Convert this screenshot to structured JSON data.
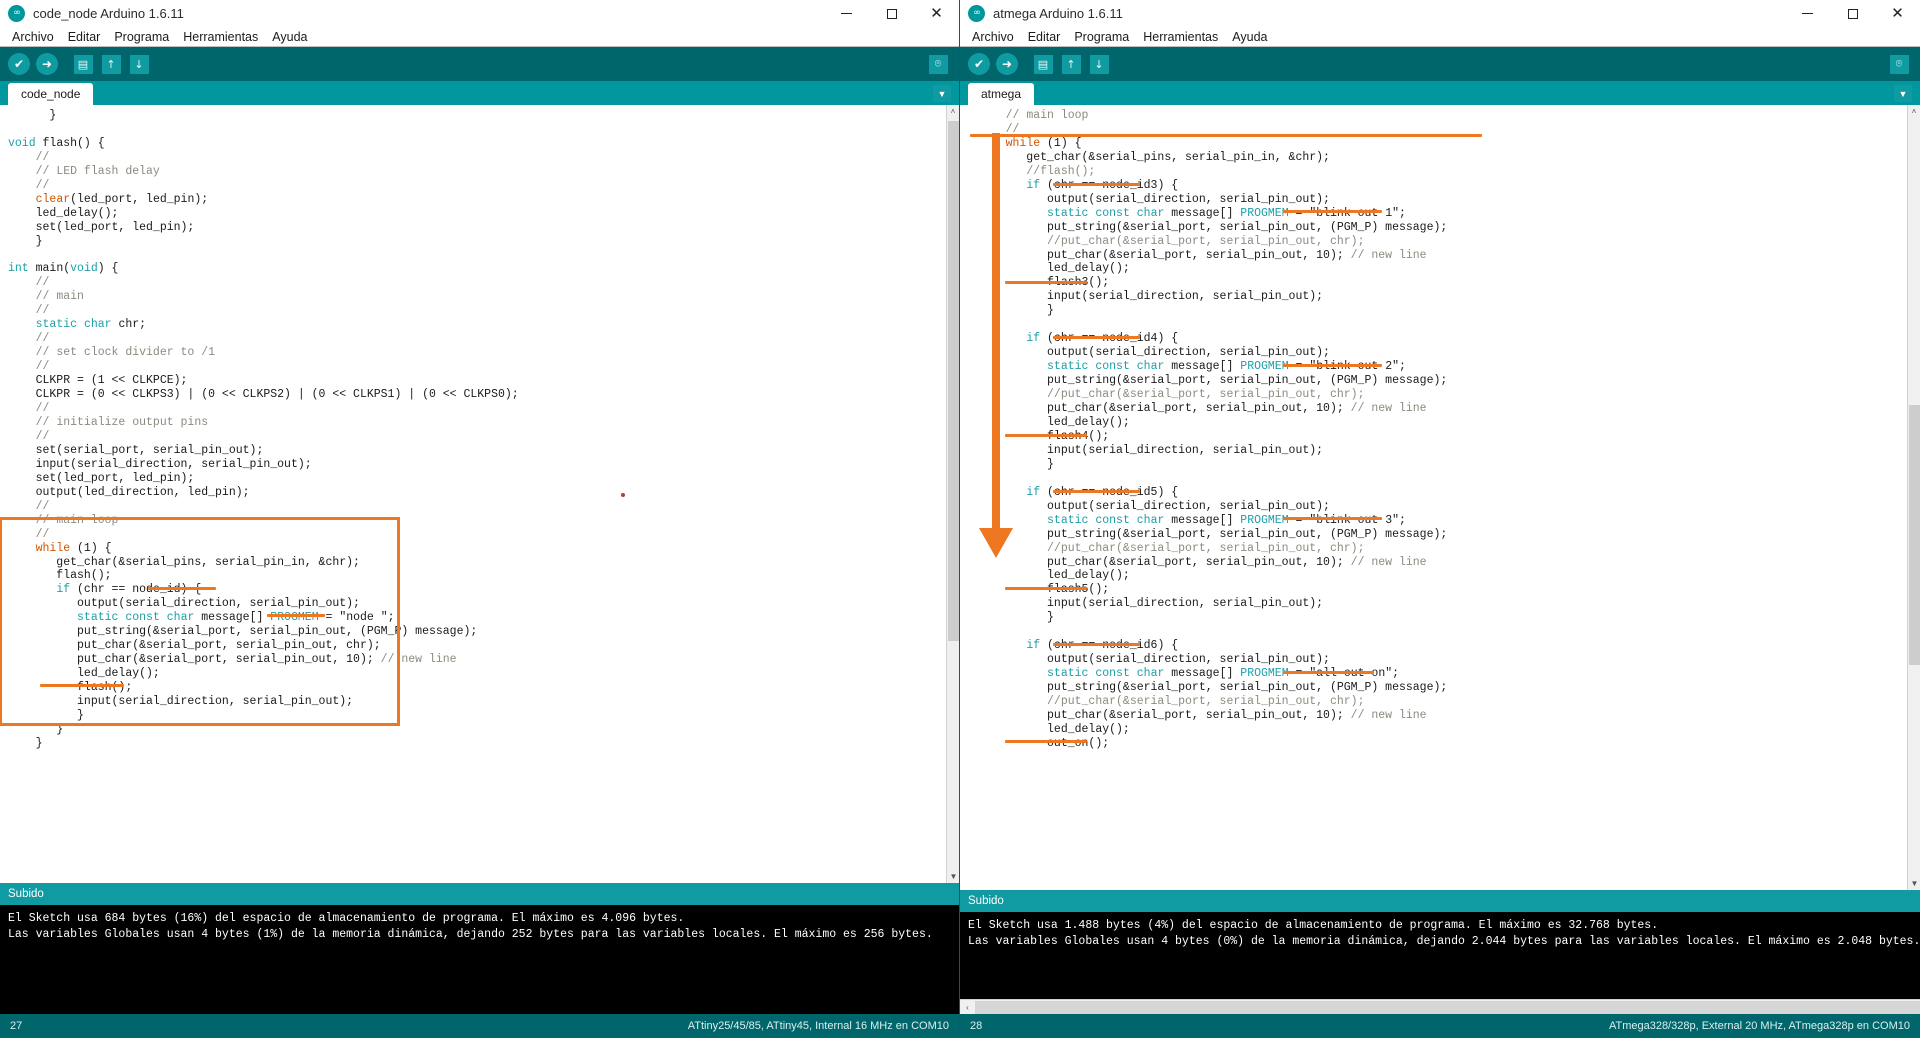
{
  "windows": {
    "left": {
      "title": "code_node Arduino 1.6.11",
      "menu": [
        "Archivo",
        "Editar",
        "Programa",
        "Herramientas",
        "Ayuda"
      ],
      "toolbar": {
        "verify": "verify-check",
        "upload": "upload-arrow",
        "new": "new-file",
        "open": "open-folder",
        "save": "save-disk",
        "serial_monitor": "serial-monitor"
      },
      "tab": "code_node",
      "status": "Subido",
      "console": [
        "El Sketch usa 684 bytes (16%) del espacio de almacenamiento de programa. El máximo es 4.096 bytes.",
        "Las variables Globales usan 4 bytes (1%) de la memoria dinámica, dejando 252 bytes para las variables locales. El máximo es 256 bytes."
      ],
      "line_number": "27",
      "board_info": "ATtiny25/45/85, ATtiny45, Internal 16 MHz en COM10",
      "code": [
        {
          "t": "      }"
        },
        {
          "t": ""
        },
        {
          "t": "<span class=\"kw\">void</span> flash() {"
        },
        {
          "t": "    <span class=\"cm\">//</span>"
        },
        {
          "t": "    <span class=\"cm\">// LED flash delay</span>"
        },
        {
          "t": "    <span class=\"cm\">//</span>"
        },
        {
          "t": "    <span class=\"kw2\">clear</span>(led_port, led_pin);"
        },
        {
          "t": "    led_delay();"
        },
        {
          "t": "    set(led_port, led_pin);"
        },
        {
          "t": "    }"
        },
        {
          "t": ""
        },
        {
          "t": "<span class=\"kw\">int</span> main(<span class=\"kw\">void</span>) {"
        },
        {
          "t": "    <span class=\"cm\">//</span>"
        },
        {
          "t": "    <span class=\"cm\">// main</span>"
        },
        {
          "t": "    <span class=\"cm\">//</span>"
        },
        {
          "t": "    <span class=\"kw\">static</span> <span class=\"kw\">char</span> chr;"
        },
        {
          "t": "    <span class=\"cm\">//</span>"
        },
        {
          "t": "    <span class=\"cm\">// set clock divider to /1</span>"
        },
        {
          "t": "    <span class=\"cm\">//</span>"
        },
        {
          "t": "    CLKPR = (1 &lt;&lt; CLKPCE);"
        },
        {
          "t": "    CLKPR = (0 &lt;&lt; CLKPS3) | (0 &lt;&lt; CLKPS2) | (0 &lt;&lt; CLKPS1) | (0 &lt;&lt; CLKPS0);"
        },
        {
          "t": "    <span class=\"cm\">//</span>"
        },
        {
          "t": "    <span class=\"cm\">// initialize output pins</span>"
        },
        {
          "t": "    <span class=\"cm\">//</span>"
        },
        {
          "t": "    set(serial_port, serial_pin_out);"
        },
        {
          "t": "    input(serial_direction, serial_pin_out);"
        },
        {
          "t": "    set(led_port, led_pin);"
        },
        {
          "t": "    output(led_direction, led_pin);"
        },
        {
          "t": "    <span class=\"cm\">//</span>"
        },
        {
          "t": "    <span class=\"cm\">// main loop</span>"
        },
        {
          "t": "    <span class=\"cm\">//</span>"
        },
        {
          "t": "    <span class=\"kw2\">while</span> (1) {"
        },
        {
          "t": "       get_char(&amp;serial_pins, serial_pin_in, &amp;chr);"
        },
        {
          "t": "       flash();"
        },
        {
          "t": "       <span class=\"kw\">if</span> (chr == node_id) {"
        },
        {
          "t": "          output(serial_direction, serial_pin_out);"
        },
        {
          "t": "          <span class=\"kw\">static</span> <span class=\"kw\">const</span> <span class=\"kw\">char</span> message[] <span class=\"kw\">PROGMEM</span> = \"node \";"
        },
        {
          "t": "          put_string(&amp;serial_port, serial_pin_out, (PGM_P) message);"
        },
        {
          "t": "          put_char(&amp;serial_port, serial_pin_out, chr);"
        },
        {
          "t": "          put_char(&amp;serial_port, serial_pin_out, 10); <span class=\"cm\">// new line</span>"
        },
        {
          "t": "          led_delay();"
        },
        {
          "t": "          flash();"
        },
        {
          "t": "          input(serial_direction, serial_pin_out);"
        },
        {
          "t": "          }"
        },
        {
          "t": "       }"
        },
        {
          "t": "    }"
        }
      ]
    },
    "right": {
      "title": "atmega Arduino 1.6.11",
      "menu": [
        "Archivo",
        "Editar",
        "Programa",
        "Herramientas",
        "Ayuda"
      ],
      "tab": "atmega",
      "status": "Subido",
      "console": [
        "El Sketch usa 1.488 bytes (4%) del espacio de almacenamiento de programa. El máximo es 32.768 bytes.",
        "Las variables Globales usan 4 bytes (0%) de la memoria dinámica, dejando 2.044 bytes para las variables locales. El máximo es 2.048 bytes."
      ],
      "line_number": "28",
      "board_info": "ATmega328/328p, External 20 MHz, ATmega328p en COM10",
      "code": [
        {
          "t": "    <span class=\"cm\">// main loop</span>"
        },
        {
          "t": "    <span class=\"cm\">//</span>"
        },
        {
          "t": "    <span class=\"kw2\">while</span> (1) {"
        },
        {
          "t": "       get_char(&amp;serial_pins, serial_pin_in, &amp;chr);"
        },
        {
          "t": "       <span class=\"cm\">//flash();</span>"
        },
        {
          "t": "       <span class=\"kw\">if</span> (chr == node_id3) {"
        },
        {
          "t": "          output(serial_direction, serial_pin_out);"
        },
        {
          "t": "          <span class=\"kw\">static</span> <span class=\"kw\">const</span> <span class=\"kw\">char</span> message[] <span class=\"kw\">PROGMEM</span> = \"blink out 1\";"
        },
        {
          "t": "          put_string(&amp;serial_port, serial_pin_out, (PGM_P) message);"
        },
        {
          "t": "          <span class=\"cm\">//put_char(&amp;serial_port, serial_pin_out, chr);</span>"
        },
        {
          "t": "          put_char(&amp;serial_port, serial_pin_out, 10); <span class=\"cm\">// new line</span>"
        },
        {
          "t": "          led_delay();"
        },
        {
          "t": "          flash3();"
        },
        {
          "t": "          input(serial_direction, serial_pin_out);"
        },
        {
          "t": "          }"
        },
        {
          "t": ""
        },
        {
          "t": "       <span class=\"kw\">if</span> (chr == node_id4) {"
        },
        {
          "t": "          output(serial_direction, serial_pin_out);"
        },
        {
          "t": "          <span class=\"kw\">static</span> <span class=\"kw\">const</span> <span class=\"kw\">char</span> message[] <span class=\"kw\">PROGMEM</span> = \"blink out 2\";"
        },
        {
          "t": "          put_string(&amp;serial_port, serial_pin_out, (PGM_P) message);"
        },
        {
          "t": "          <span class=\"cm\">//put_char(&amp;serial_port, serial_pin_out, chr);</span>"
        },
        {
          "t": "          put_char(&amp;serial_port, serial_pin_out, 10); <span class=\"cm\">// new line</span>"
        },
        {
          "t": "          led_delay();"
        },
        {
          "t": "          flash4();"
        },
        {
          "t": "          input(serial_direction, serial_pin_out);"
        },
        {
          "t": "          }"
        },
        {
          "t": ""
        },
        {
          "t": "       <span class=\"kw\">if</span> (chr == node_id5) {"
        },
        {
          "t": "          output(serial_direction, serial_pin_out);"
        },
        {
          "t": "          <span class=\"kw\">static</span> <span class=\"kw\">const</span> <span class=\"kw\">char</span> message[] <span class=\"kw\">PROGMEM</span> = \"blink out 3\";"
        },
        {
          "t": "          put_string(&amp;serial_port, serial_pin_out, (PGM_P) message);"
        },
        {
          "t": "          <span class=\"cm\">//put_char(&amp;serial_port, serial_pin_out, chr);</span>"
        },
        {
          "t": "          put_char(&amp;serial_port, serial_pin_out, 10); <span class=\"cm\">// new line</span>"
        },
        {
          "t": "          led_delay();"
        },
        {
          "t": "          flash5();"
        },
        {
          "t": "          input(serial_direction, serial_pin_out);"
        },
        {
          "t": "          }"
        },
        {
          "t": ""
        },
        {
          "t": "       <span class=\"kw\">if</span> (chr == node_id6) {"
        },
        {
          "t": "          output(serial_direction, serial_pin_out);"
        },
        {
          "t": "          <span class=\"kw\">static</span> <span class=\"kw\">const</span> <span class=\"kw\">char</span> message[] <span class=\"kw\">PROGMEM</span> = \"all out on\";"
        },
        {
          "t": "          put_string(&amp;serial_port, serial_pin_out, (PGM_P) message);"
        },
        {
          "t": "          <span class=\"cm\">//put_char(&amp;serial_port, serial_pin_out, chr);</span>"
        },
        {
          "t": "          put_char(&amp;serial_port, serial_pin_out, 10); <span class=\"cm\">// new line</span>"
        },
        {
          "t": "          led_delay();"
        },
        {
          "t": "          out_on();"
        }
      ]
    }
  },
  "annotations": {
    "color": "#ee7722",
    "left_box_label": "main-loop-highlight-box",
    "underlines": [
      "node_id",
      "\"node \"",
      "flash()",
      "node_id3",
      "\"blink out 1\"",
      "flash3()",
      "node_id4",
      "\"blink out 2\"",
      "flash4()",
      "node_id5",
      "\"blink out 3\"",
      "flash5()",
      "node_id6",
      "\"all out on\"",
      "out_on()"
    ],
    "arrow_label": "comparison-arrow"
  },
  "icons": {
    "minimize": "–",
    "maximize": "□",
    "close": "✕",
    "check": "✔",
    "right_arrow": "➜",
    "up": "↑",
    "down": "↓",
    "page": "▤",
    "magnifier": "⌾",
    "caret_down": "▼",
    "caret_up": "˄",
    "caret_left": "‹"
  }
}
